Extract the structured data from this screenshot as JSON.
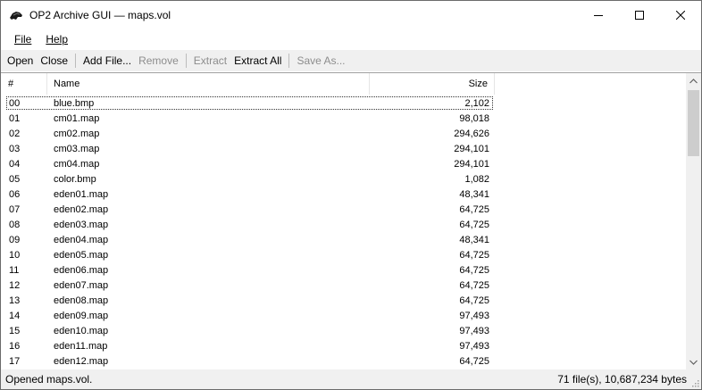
{
  "window": {
    "title": "OP2 Archive GUI — maps.vol"
  },
  "menu": {
    "file": "File",
    "help": "Help"
  },
  "toolbar": {
    "open": "Open",
    "close": "Close",
    "add_file": "Add File...",
    "remove": "Remove",
    "extract": "Extract",
    "extract_all": "Extract All",
    "save_as": "Save As..."
  },
  "list": {
    "headers": {
      "num": "#",
      "name": "Name",
      "size": "Size"
    },
    "rows": [
      {
        "num": "00",
        "name": "blue.bmp",
        "size": "2,102"
      },
      {
        "num": "01",
        "name": "cm01.map",
        "size": "98,018"
      },
      {
        "num": "02",
        "name": "cm02.map",
        "size": "294,626"
      },
      {
        "num": "03",
        "name": "cm03.map",
        "size": "294,101"
      },
      {
        "num": "04",
        "name": "cm04.map",
        "size": "294,101"
      },
      {
        "num": "05",
        "name": "color.bmp",
        "size": "1,082"
      },
      {
        "num": "06",
        "name": "eden01.map",
        "size": "48,341"
      },
      {
        "num": "07",
        "name": "eden02.map",
        "size": "64,725"
      },
      {
        "num": "08",
        "name": "eden03.map",
        "size": "64,725"
      },
      {
        "num": "09",
        "name": "eden04.map",
        "size": "48,341"
      },
      {
        "num": "10",
        "name": "eden05.map",
        "size": "64,725"
      },
      {
        "num": "11",
        "name": "eden06.map",
        "size": "64,725"
      },
      {
        "num": "12",
        "name": "eden07.map",
        "size": "64,725"
      },
      {
        "num": "13",
        "name": "eden08.map",
        "size": "64,725"
      },
      {
        "num": "14",
        "name": "eden09.map",
        "size": "97,493"
      },
      {
        "num": "15",
        "name": "eden10.map",
        "size": "97,493"
      },
      {
        "num": "16",
        "name": "eden11.map",
        "size": "97,493"
      },
      {
        "num": "17",
        "name": "eden12.map",
        "size": "64,725"
      }
    ]
  },
  "status": {
    "left": "Opened maps.vol.",
    "right": "71 file(s), 10,687,234 bytes"
  }
}
